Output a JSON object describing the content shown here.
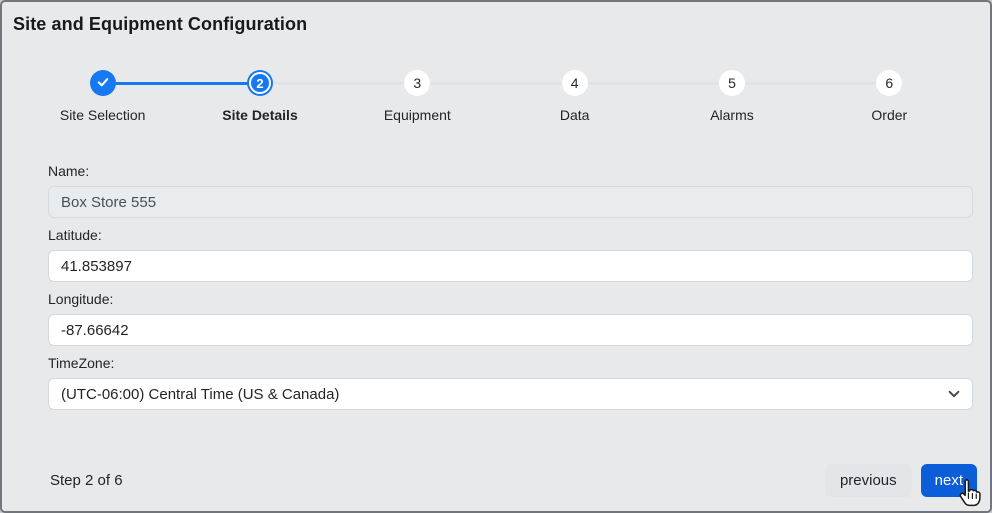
{
  "window": {
    "title": "Site and Equipment Configuration"
  },
  "stepper": {
    "steps": [
      {
        "label": "Site Selection",
        "number": "",
        "icon": "check-icon",
        "state": "completed"
      },
      {
        "label": "Site Details",
        "number": "2",
        "state": "active"
      },
      {
        "label": "Equipment",
        "number": "3",
        "state": "upcoming"
      },
      {
        "label": "Data",
        "number": "4",
        "state": "upcoming"
      },
      {
        "label": "Alarms",
        "number": "5",
        "state": "upcoming"
      },
      {
        "label": "Order",
        "number": "6",
        "state": "upcoming"
      }
    ]
  },
  "form": {
    "fields": [
      {
        "label": "Name:",
        "value": "Box Store 555",
        "disabled": true
      },
      {
        "label": "Latitude:",
        "value": "41.853897"
      },
      {
        "label": "Longitude:",
        "value": "-87.66642"
      },
      {
        "label": "TimeZone:",
        "value": "(UTC-06:00) Central Time (US & Canada)",
        "type": "select"
      }
    ]
  },
  "footer": {
    "progress_label": "Step 2 of 6",
    "previous_label": "previous",
    "next_label": "next"
  },
  "colors": {
    "accent_blue": "#1678f2",
    "primary_button": "#0b5ed7",
    "page_background": "#e8e9ea",
    "disabled_input_background": "#e9ecef"
  }
}
